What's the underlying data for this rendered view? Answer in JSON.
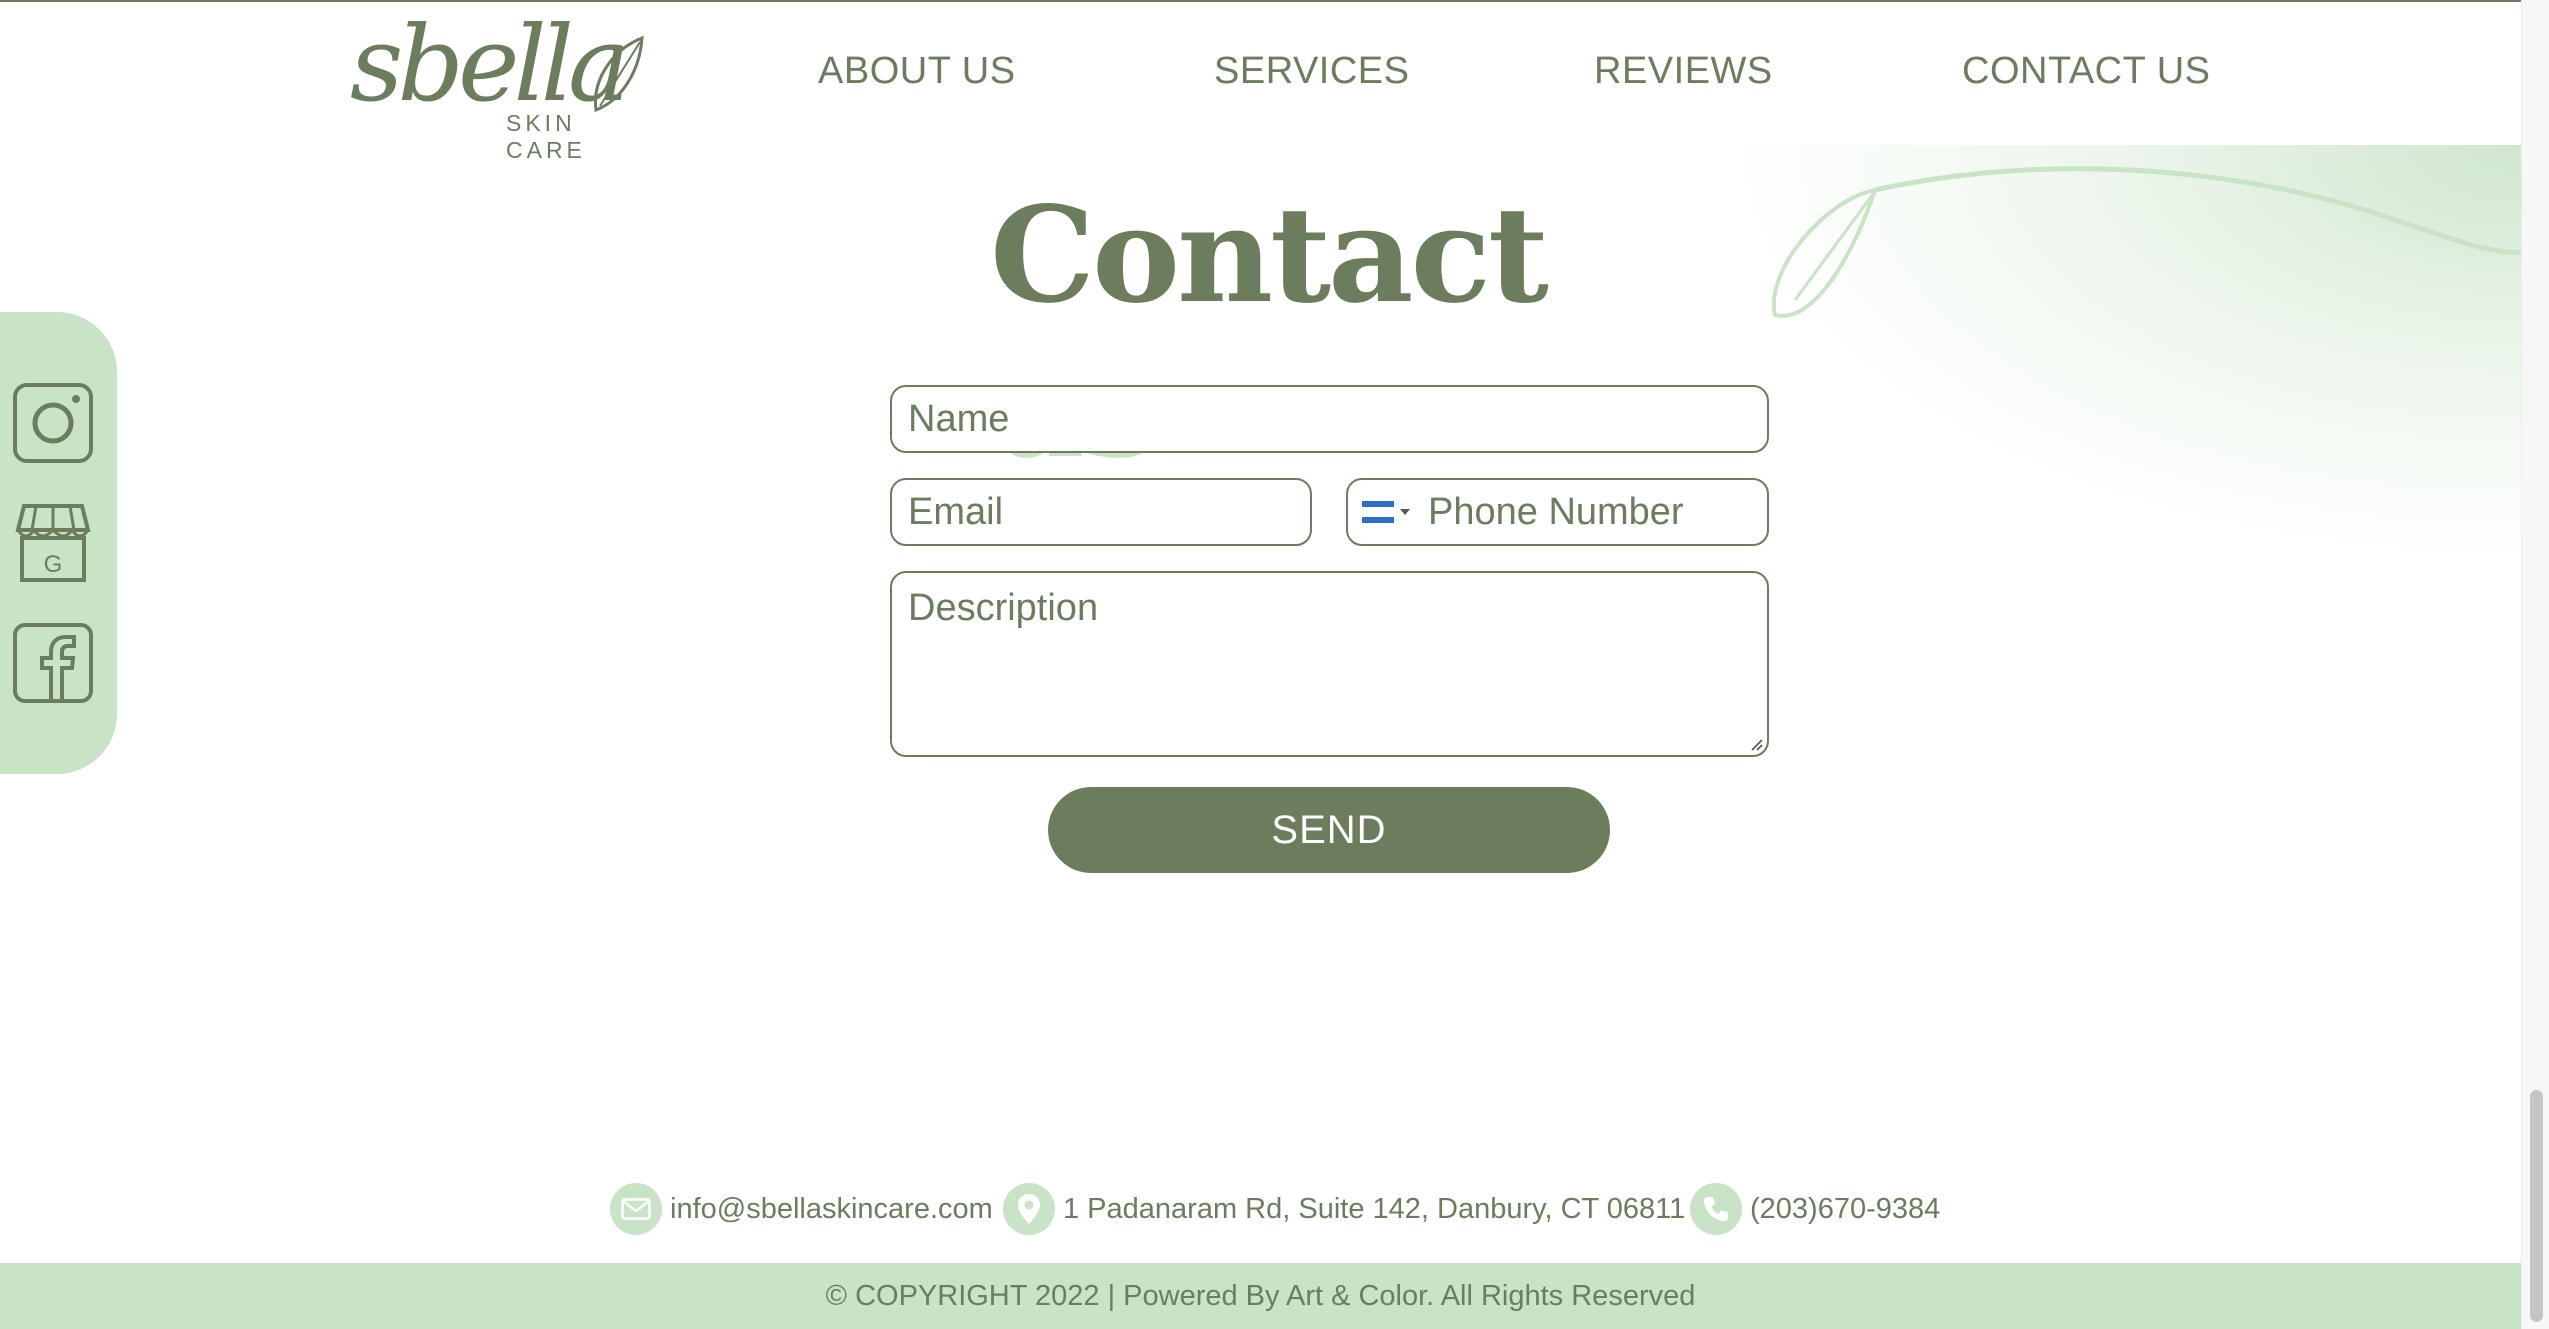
{
  "brand": {
    "logo_wordmark": "sbella",
    "logo_subtitle": "SKIN CARE",
    "primary_color": "#6b7d5c",
    "accent_color": "#c8e3c6"
  },
  "nav": {
    "items": [
      {
        "label": "ABOUT US"
      },
      {
        "label": "SERVICES"
      },
      {
        "label": "REVIEWS"
      },
      {
        "label": "CONTACT US"
      }
    ]
  },
  "social": {
    "icons": [
      "instagram-icon",
      "google-business-icon",
      "facebook-icon"
    ]
  },
  "contact_title": {
    "part1": "Contact",
    "part2": "us"
  },
  "form": {
    "name_placeholder": "Name",
    "email_placeholder": "Email",
    "phone_placeholder": "Phone Number",
    "description_placeholder": "Description",
    "send_label": "SEND"
  },
  "contact_info": {
    "email": "info@sbellaskincare.com",
    "address": "1 Padanaram Rd, Suite 142, Danbury, CT 06811",
    "phone": "(203)670-9384"
  },
  "footer": {
    "text": "© COPYRIGHT 2022 | Powered By Art & Color. All Rights Reserved"
  }
}
